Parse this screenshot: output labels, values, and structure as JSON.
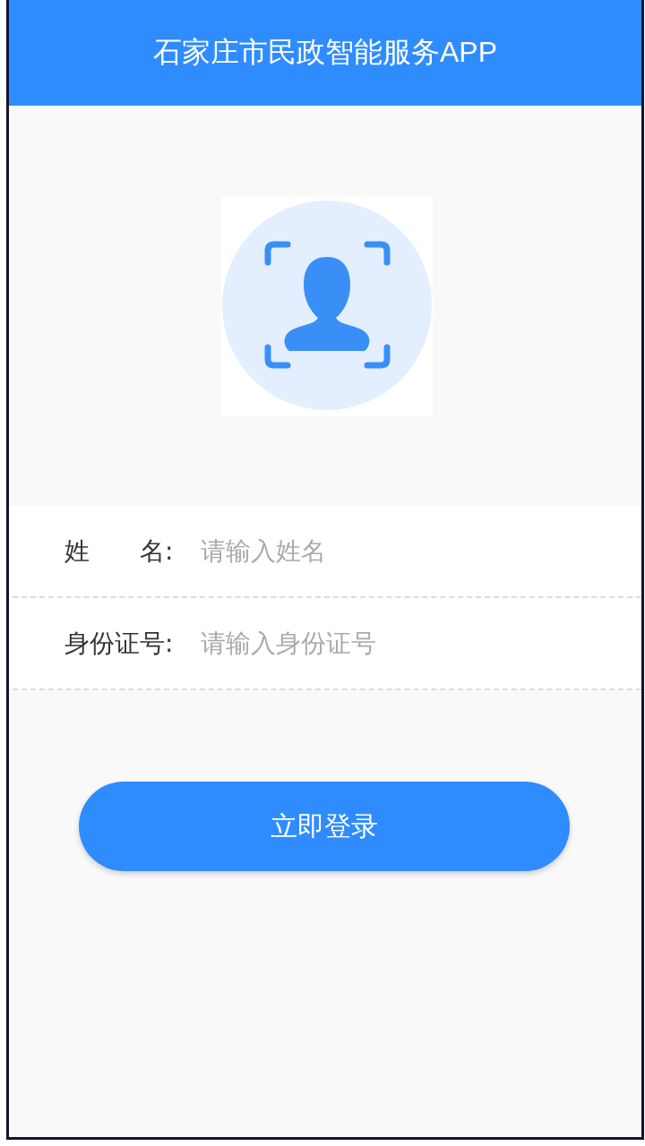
{
  "header": {
    "title": "石家庄市民政智能服务APP"
  },
  "form": {
    "fields": [
      {
        "label": "姓　　名:",
        "placeholder": "请输入姓名"
      },
      {
        "label": "身份证号:",
        "placeholder": "请输入身份证号"
      }
    ]
  },
  "login_button": {
    "label": "立即登录"
  }
}
